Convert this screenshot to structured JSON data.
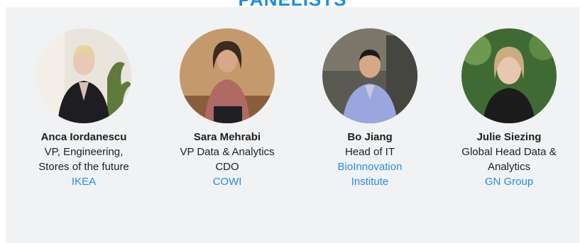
{
  "section": {
    "heading": "PANELISTS"
  },
  "panelists": [
    {
      "name": "Anca Iordanescu",
      "role_line1": "VP, Engineering,",
      "role_line2": "Stores of the future",
      "org_line1": "IKEA",
      "org_line2": ""
    },
    {
      "name": "Sara Mehrabi",
      "role_line1": "VP Data & Analytics",
      "role_line2": "CDO",
      "org_line1": "COWI",
      "org_line2": ""
    },
    {
      "name": "Bo Jiang",
      "role_line1": "Head of IT",
      "role_line2": "",
      "org_line1": "BioInnovation",
      "org_line2": "Institute"
    },
    {
      "name": "Julie Siezing",
      "role_line1": "Global Head Data &",
      "role_line2": "Analytics",
      "org_line1": "GN Group",
      "org_line2": ""
    }
  ],
  "colors": {
    "accent": "#1a8fe0",
    "org_link": "#2a8de0",
    "panel_bg": "#f0f2f4"
  }
}
